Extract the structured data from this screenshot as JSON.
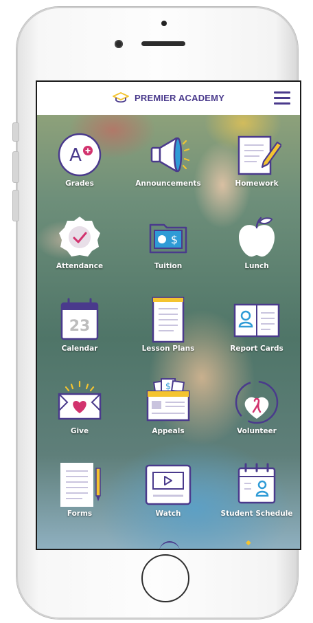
{
  "header": {
    "brand": "PREMIER ACADEMY"
  },
  "icons": {
    "brand": "graduation-cap-icon",
    "menu": "hamburger-menu-icon"
  },
  "colors": {
    "brand": "#4a3a8c",
    "accent_yellow": "#f4c430",
    "accent_pink": "#d2336e",
    "tile_fill": "#ffffff"
  },
  "tiles": [
    {
      "label": "Grades",
      "icon": "grades-icon"
    },
    {
      "label": "Announcements",
      "icon": "megaphone-icon"
    },
    {
      "label": "Homework",
      "icon": "homework-icon"
    },
    {
      "label": "Attendance",
      "icon": "attendance-badge-icon"
    },
    {
      "label": "Tuition",
      "icon": "tuition-wallet-icon"
    },
    {
      "label": "Lunch",
      "icon": "apple-icon"
    },
    {
      "label": "Calendar",
      "icon": "calendar-icon"
    },
    {
      "label": "Lesson Plans",
      "icon": "lesson-plans-icon"
    },
    {
      "label": "Report Cards",
      "icon": "report-card-icon"
    },
    {
      "label": "Give",
      "icon": "give-heart-icon"
    },
    {
      "label": "Appeals",
      "icon": "appeals-icon"
    },
    {
      "label": "Volunteer",
      "icon": "volunteer-ribbon-icon"
    },
    {
      "label": "Forms",
      "icon": "forms-icon"
    },
    {
      "label": "Watch",
      "icon": "watch-video-icon"
    },
    {
      "label": "Student Schedule",
      "icon": "student-schedule-icon"
    }
  ],
  "grades_icon_text": "A+",
  "calendar_icon_text": "23",
  "tuition_icon_text": "$",
  "appeals_icon_text": "$"
}
